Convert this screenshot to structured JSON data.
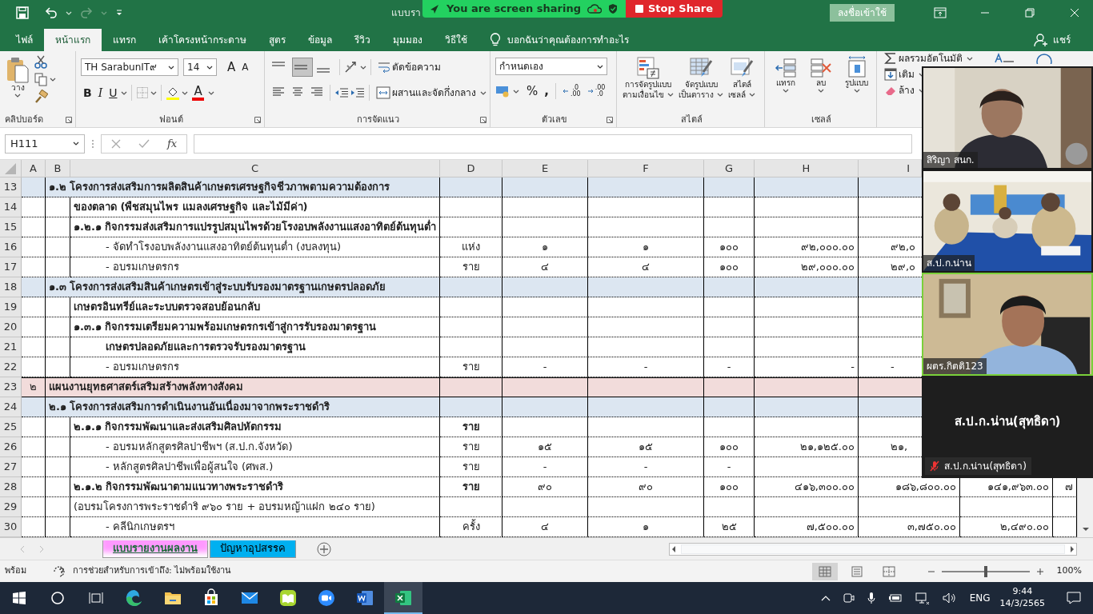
{
  "title_bar": {
    "title": "แบบรา",
    "sign_in": "ลงชื่อเข้าใช้"
  },
  "share_banner": {
    "status": "You are screen sharing",
    "stop": "Stop Share"
  },
  "ribbon_tabs": [
    {
      "label": "ไฟล์",
      "selected": false
    },
    {
      "label": "หน้าแรก",
      "selected": true
    },
    {
      "label": "แทรก",
      "selected": false
    },
    {
      "label": "เค้าโครงหน้ากระดาษ",
      "selected": false
    },
    {
      "label": "สูตร",
      "selected": false
    },
    {
      "label": "ข้อมูล",
      "selected": false
    },
    {
      "label": "รีวิว",
      "selected": false
    },
    {
      "label": "มุมมอง",
      "selected": false
    },
    {
      "label": "วิธีใช้",
      "selected": false
    }
  ],
  "tell_me": "บอกฉันว่าคุณต้องการทำอะไร",
  "share": "แชร์",
  "ribbon": {
    "clipboard": {
      "paste": "วาง",
      "label": "คลิปบอร์ด"
    },
    "font": {
      "name": "TH SarabunIT๙",
      "size": "14",
      "grow": "A",
      "shrink": "A",
      "bold": "B",
      "italic": "I",
      "underline": "U",
      "font_color": "A",
      "label": "ฟอนต์"
    },
    "alignment": {
      "vertical": [
        {
          "selected": false
        },
        {
          "selected": true
        },
        {
          "selected": false
        }
      ],
      "wrap": "ตัดข้อความ",
      "merge": "ผสานและจัดกึ่งกลาง",
      "label": "การจัดแนว"
    },
    "number": {
      "format": "กำหนดเอง",
      "percent": "%",
      "comma": ",",
      "decimals": [
        {
          "top": ".0",
          "bottom": ".00"
        },
        {
          "top": ".00",
          "bottom": ".0"
        }
      ],
      "label": "ตัวเลข"
    },
    "styles": {
      "buttons": [
        {
          "lines": [
            "การจัดรูปแบบ",
            "ตามเงื่อนไข"
          ]
        },
        {
          "lines": [
            "จัดรูปแบบ",
            "เป็นตาราง"
          ]
        },
        {
          "lines": [
            "สไตล์",
            "เซลล์"
          ]
        }
      ],
      "label": "สไตล์"
    },
    "cells": {
      "buttons": [
        "แทรก",
        "ลบ",
        "รูปแบบ"
      ],
      "label": "เซลล์"
    },
    "editing": {
      "autosum": "ผลรวมอัตโนมัติ",
      "fill": "เติม",
      "clear": "ล้าง"
    }
  },
  "formula_bar": {
    "name_box": "H111",
    "fx": "fx"
  },
  "columns": [
    "A",
    "B",
    "C",
    "D",
    "E",
    "F",
    "G",
    "H",
    "I"
  ],
  "rows": [
    {
      "num": "13",
      "kind": "section",
      "text": "๑.๒ โครงการส่งเสริมการผลิตสินค้าเกษตรเศรษฐกิจชีวภาพตามความต้องการ",
      "bold": true,
      "color": "#dce6f1"
    },
    {
      "num": "14",
      "kind": "heading",
      "text": "ของตลาด (พืชสมุนไพร แมลงเศรษฐกิจ และไม้มีค่า)",
      "bold": true
    },
    {
      "num": "15",
      "kind": "heading",
      "text": "๑.๒.๑ กิจกรรมส่งเสริมการแปรรูปสมุนไพรด้วยโรงอบพลังงานแสงอาทิตย์ต้นทุนต่ำ",
      "bold": true
    },
    {
      "num": "16",
      "kind": "item",
      "text": "- จัดทำโรงอบพลังงานแสงอาทิตย์ต้นทุนต่ำ (งบลงทุน)",
      "bold": false,
      "d": "แห่ง",
      "e": "๑",
      "f": "๑",
      "g": "๑๐๐",
      "h": "๙๒,๐๐๐.๐๐",
      "i": "๙๒,๐"
    },
    {
      "num": "17",
      "kind": "item",
      "text": "- อบรมเกษตรกร",
      "bold": false,
      "d": "ราย",
      "e": "๔",
      "f": "๔",
      "g": "๑๐๐",
      "h": "๒๙,๐๐๐.๐๐",
      "i": "๒๙,๐"
    },
    {
      "num": "18",
      "kind": "section",
      "text": "๑.๓ โครงการส่งเสริมสินค้าเกษตรเข้าสู่ระบบรับรองมาตรฐานเกษตรปลอดภัย",
      "bold": true,
      "color": "#dce6f1"
    },
    {
      "num": "19",
      "kind": "heading",
      "text": "เกษตรอินทรีย์และระบบตรวจสอบย้อนกลับ",
      "bold": true
    },
    {
      "num": "20",
      "kind": "heading",
      "text": "๑.๓.๑ กิจกรรมเตรียมความพร้อมเกษตรกรเข้าสู่การรับรองมาตรฐาน",
      "bold": true
    },
    {
      "num": "21",
      "kind": "item",
      "text": "เกษตรปลอดภัยและการตรวจรับรองมาตรฐาน",
      "bold": true
    },
    {
      "num": "22",
      "kind": "item",
      "text": "- อบรมเกษตรกร",
      "bold": false,
      "d": "ราย",
      "e": "-",
      "f": "-",
      "g": "-",
      "h": "-",
      "i": "-"
    },
    {
      "num": "23",
      "kind": "plan",
      "a": "๒",
      "text": "แผนงานยุทธศาสตร์เสริมสร้างพลังทางสังคม",
      "bold": true,
      "color": "#f2dcdb"
    },
    {
      "num": "24",
      "kind": "section",
      "text": "๒.๑  โครงการส่งเสริมการดำเนินงานอันเนื่องมาจากพระราชดำริ",
      "bold": true,
      "color": "#dce6f1"
    },
    {
      "num": "25",
      "kind": "heading",
      "text": "๒.๑.๑ กิจกรรมพัฒนาและส่งเสริมศิลปหัตกรรม",
      "bold": true,
      "d": "ราย"
    },
    {
      "num": "26",
      "kind": "item",
      "text": "- อบรมหลักสูตรศิลปาชีพฯ (ส.ป.ก.จังหวัด)",
      "bold": false,
      "d": "ราย",
      "e": "๑๕",
      "f": "๑๕",
      "g": "๑๐๐",
      "h": "๒๑,๑๒๕.๐๐",
      "i": "๒๑,"
    },
    {
      "num": "27",
      "kind": "item",
      "text": "- หลักสูตรศิลปาชีพเพื่อผู้สนใจ (ศพส.)",
      "bold": false,
      "d": "ราย",
      "e": "-",
      "f": "-",
      "g": "-"
    },
    {
      "num": "28",
      "kind": "heading",
      "text": "๒.๑.๒ กิจกรรมพัฒนาตามแนวทางพระราชดำริ",
      "bold": true,
      "d": "ราย",
      "e": "๙๐",
      "f": "๙๐",
      "g": "๑๐๐",
      "h": "๔๑๖,๓๐๐.๐๐",
      "i": "๑๘๖,๘๐๐.๐๐",
      "j": "๑๔๑,๙๖๓.๐๐",
      "k": "๗"
    },
    {
      "num": "29",
      "kind": "heading",
      "text": "(อบรมโครงการพระราชดำริ ๙๖๐ ราย + อบรมหญ้าแฝก ๒๔๐ ราย)",
      "bold": false
    },
    {
      "num": "30",
      "kind": "item",
      "text": "- คลีนิกเกษตรฯ",
      "bold": false,
      "d": "ครั้ง",
      "e": "๔",
      "f": "๑",
      "g": "๒๕",
      "h": "๗,๕๐๐.๐๐",
      "i": "๓,๗๕๐.๐๐",
      "j": "๒,๔๙๐.๐๐"
    }
  ],
  "sheet_tabs": [
    {
      "label": "แบบรายงานผลงาน",
      "selected": true,
      "color": "#ff99ff"
    },
    {
      "label": "ปัญหาอุปสรรค",
      "selected": false,
      "color": "#00b0f0"
    }
  ],
  "status_bar": {
    "ready": "พร้อม",
    "accessibility": "การช่วยสำหรับการเข้าถึง: ไม่พร้อมใช้งาน",
    "views": [
      {
        "kind": "normal",
        "selected": true
      },
      {
        "kind": "layout",
        "selected": false
      },
      {
        "kind": "break",
        "selected": false
      }
    ],
    "level": 0.5,
    "zoom": "100%"
  },
  "video_panel": {
    "tiles": [
      {
        "name": "สิริญา สนก.",
        "active": false,
        "kind": "woman"
      },
      {
        "name": "ส.ป.ก.น่าน",
        "active": false,
        "kind": "meeting"
      },
      {
        "name": "ผตร.กิตติ123",
        "active": true,
        "kind": "man"
      }
    ],
    "self": {
      "name": "ส.ป.ก.น่าน(สุทธิดา)",
      "label": "ส.ป.ก.น่าน(สุทธิดา)",
      "muted": true
    }
  },
  "taskbar": {
    "apps": [
      {
        "kind": "edge",
        "selected": false
      },
      {
        "kind": "folder",
        "selected": false
      },
      {
        "kind": "store",
        "selected": false
      },
      {
        "kind": "mail",
        "selected": false
      },
      {
        "kind": "book",
        "selected": false
      },
      {
        "kind": "video",
        "selected": false
      },
      {
        "kind": "word",
        "selected": false
      },
      {
        "kind": "excel",
        "selected": true
      }
    ],
    "language": "ENG",
    "time": "9:44",
    "date": "14/3/2565"
  }
}
